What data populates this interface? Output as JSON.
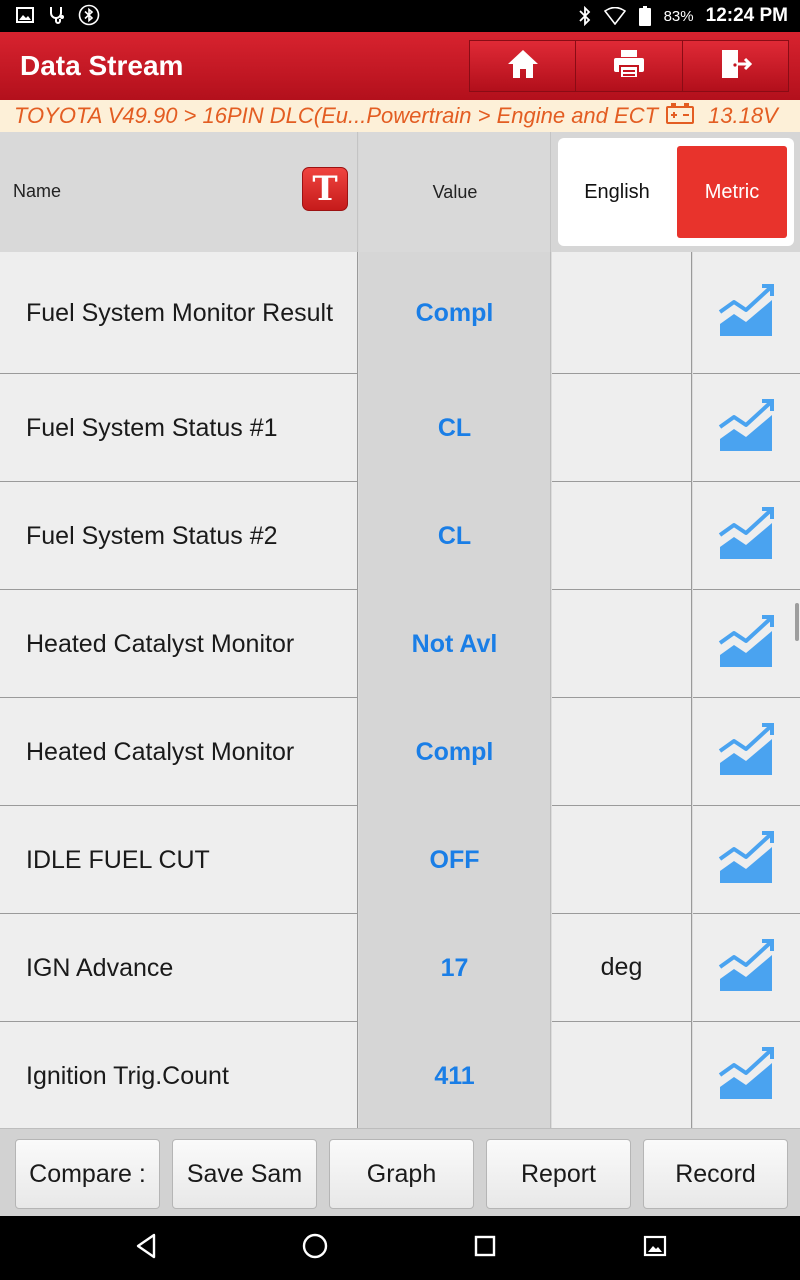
{
  "statusbar": {
    "battery": "83%",
    "time": "12:24 PM"
  },
  "appbar": {
    "title": "Data Stream",
    "buttons": [
      "home-icon",
      "print-icon",
      "exit-icon"
    ]
  },
  "breadcrumb": {
    "path": "TOYOTA V49.90 > 16PIN DLC(Eu...Powertrain > Engine and ECT",
    "voltage": "13.18V"
  },
  "header": {
    "name_label": "Name",
    "value_label": "Value",
    "unit_options": [
      "English",
      "Metric"
    ],
    "selected_unit": "Metric"
  },
  "rows": [
    {
      "name": "Fuel System Monitor Result",
      "value": "Compl",
      "unit": ""
    },
    {
      "name": "Fuel System Status #1",
      "value": "CL",
      "unit": ""
    },
    {
      "name": "Fuel System Status #2",
      "value": "CL",
      "unit": ""
    },
    {
      "name": "Heated Catalyst Monitor",
      "value": "Not Avl",
      "unit": ""
    },
    {
      "name": "Heated Catalyst Monitor",
      "value": "Compl",
      "unit": ""
    },
    {
      "name": "IDLE FUEL CUT",
      "value": "OFF",
      "unit": ""
    },
    {
      "name": "IGN Advance",
      "value": "17",
      "unit": "deg"
    },
    {
      "name": "Ignition Trig.Count",
      "value": "411",
      "unit": ""
    }
  ],
  "toolbar": {
    "compare": "Compare :",
    "save": "Save Sam",
    "graph": "Graph",
    "report": "Report",
    "record": "Record"
  },
  "colors": {
    "accent_red": "#d8232f",
    "value_blue": "#1a7ee6",
    "breadcrumb_orange": "#e35d22",
    "graph_icon_blue": "#4aa3f0"
  }
}
